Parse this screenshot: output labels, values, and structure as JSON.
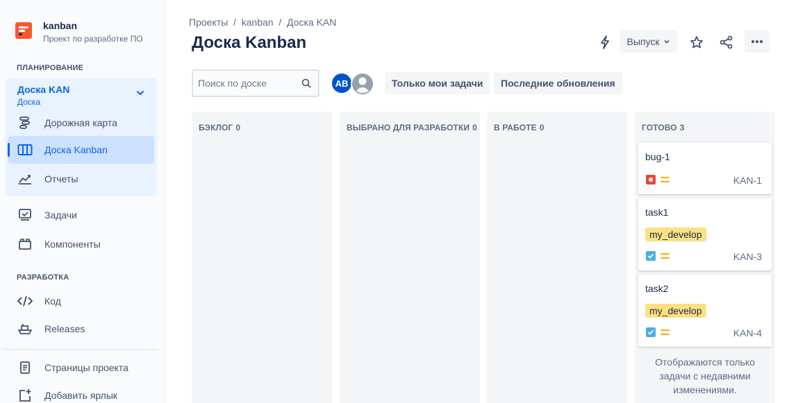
{
  "project": {
    "name": "kanban",
    "subtitle": "Проект по разработке ПО",
    "logo_color": "#ff5630"
  },
  "sidebar": {
    "planning_title": "ПЛАНИРОВАНИЕ",
    "board_group": {
      "title": "Доска KAN",
      "subtitle": "Доска"
    },
    "planning_items": [
      {
        "label": "Дорожная карта",
        "icon": "roadmap-icon"
      },
      {
        "label": "Доска Kanban",
        "icon": "board-icon",
        "active": true
      },
      {
        "label": "Отчеты",
        "icon": "reports-icon"
      }
    ],
    "items": [
      {
        "label": "Задачи",
        "icon": "issues-icon"
      },
      {
        "label": "Компоненты",
        "icon": "components-icon"
      }
    ],
    "dev_title": "РАЗРАБОТКА",
    "dev_items": [
      {
        "label": "Код",
        "icon": "code-icon"
      },
      {
        "label": "Releases",
        "icon": "releases-icon"
      }
    ],
    "bottom_items": [
      {
        "label": "Страницы проекта",
        "icon": "pages-icon"
      },
      {
        "label": "Добавить ярлык",
        "icon": "add-shortcut-icon"
      }
    ]
  },
  "breadcrumb": [
    "Проекты",
    "kanban",
    "Доска KAN"
  ],
  "page_title": "Доска Kanban",
  "toolbar": {
    "release_label": "Выпуск"
  },
  "search": {
    "placeholder": "Поиск по доске",
    "value": ""
  },
  "avatars": [
    {
      "initials": "AB",
      "color": "#0052cc"
    },
    {
      "initials": "",
      "color": "#97a0af"
    }
  ],
  "filters": [
    "Только мои задачи",
    "Последние обновления"
  ],
  "columns": [
    {
      "name": "БЭКЛОГ",
      "count": "0",
      "cards": []
    },
    {
      "name": "ВЫБРАНО ДЛЯ РАЗРАБОТКИ",
      "count": "0",
      "cards": []
    },
    {
      "name": "В РАБОТЕ",
      "count": "0",
      "cards": []
    },
    {
      "name": "ГОТОВО",
      "count": "3",
      "cards": [
        {
          "title": "bug-1",
          "label": "",
          "type": "bug",
          "type_color": "#e5493a",
          "priority": "medium",
          "priority_color": "#ffab00",
          "key": "KAN-1"
        },
        {
          "title": "task1",
          "label": "my_develop",
          "type": "task",
          "type_color": "#4bade8",
          "priority": "medium",
          "priority_color": "#ffab00",
          "key": "KAN-3"
        },
        {
          "title": "task2",
          "label": "my_develop",
          "type": "task",
          "type_color": "#4bade8",
          "priority": "medium",
          "priority_color": "#ffab00",
          "key": "KAN-4"
        }
      ],
      "note": "Отображаются только задачи с недавними изменениями."
    }
  ]
}
